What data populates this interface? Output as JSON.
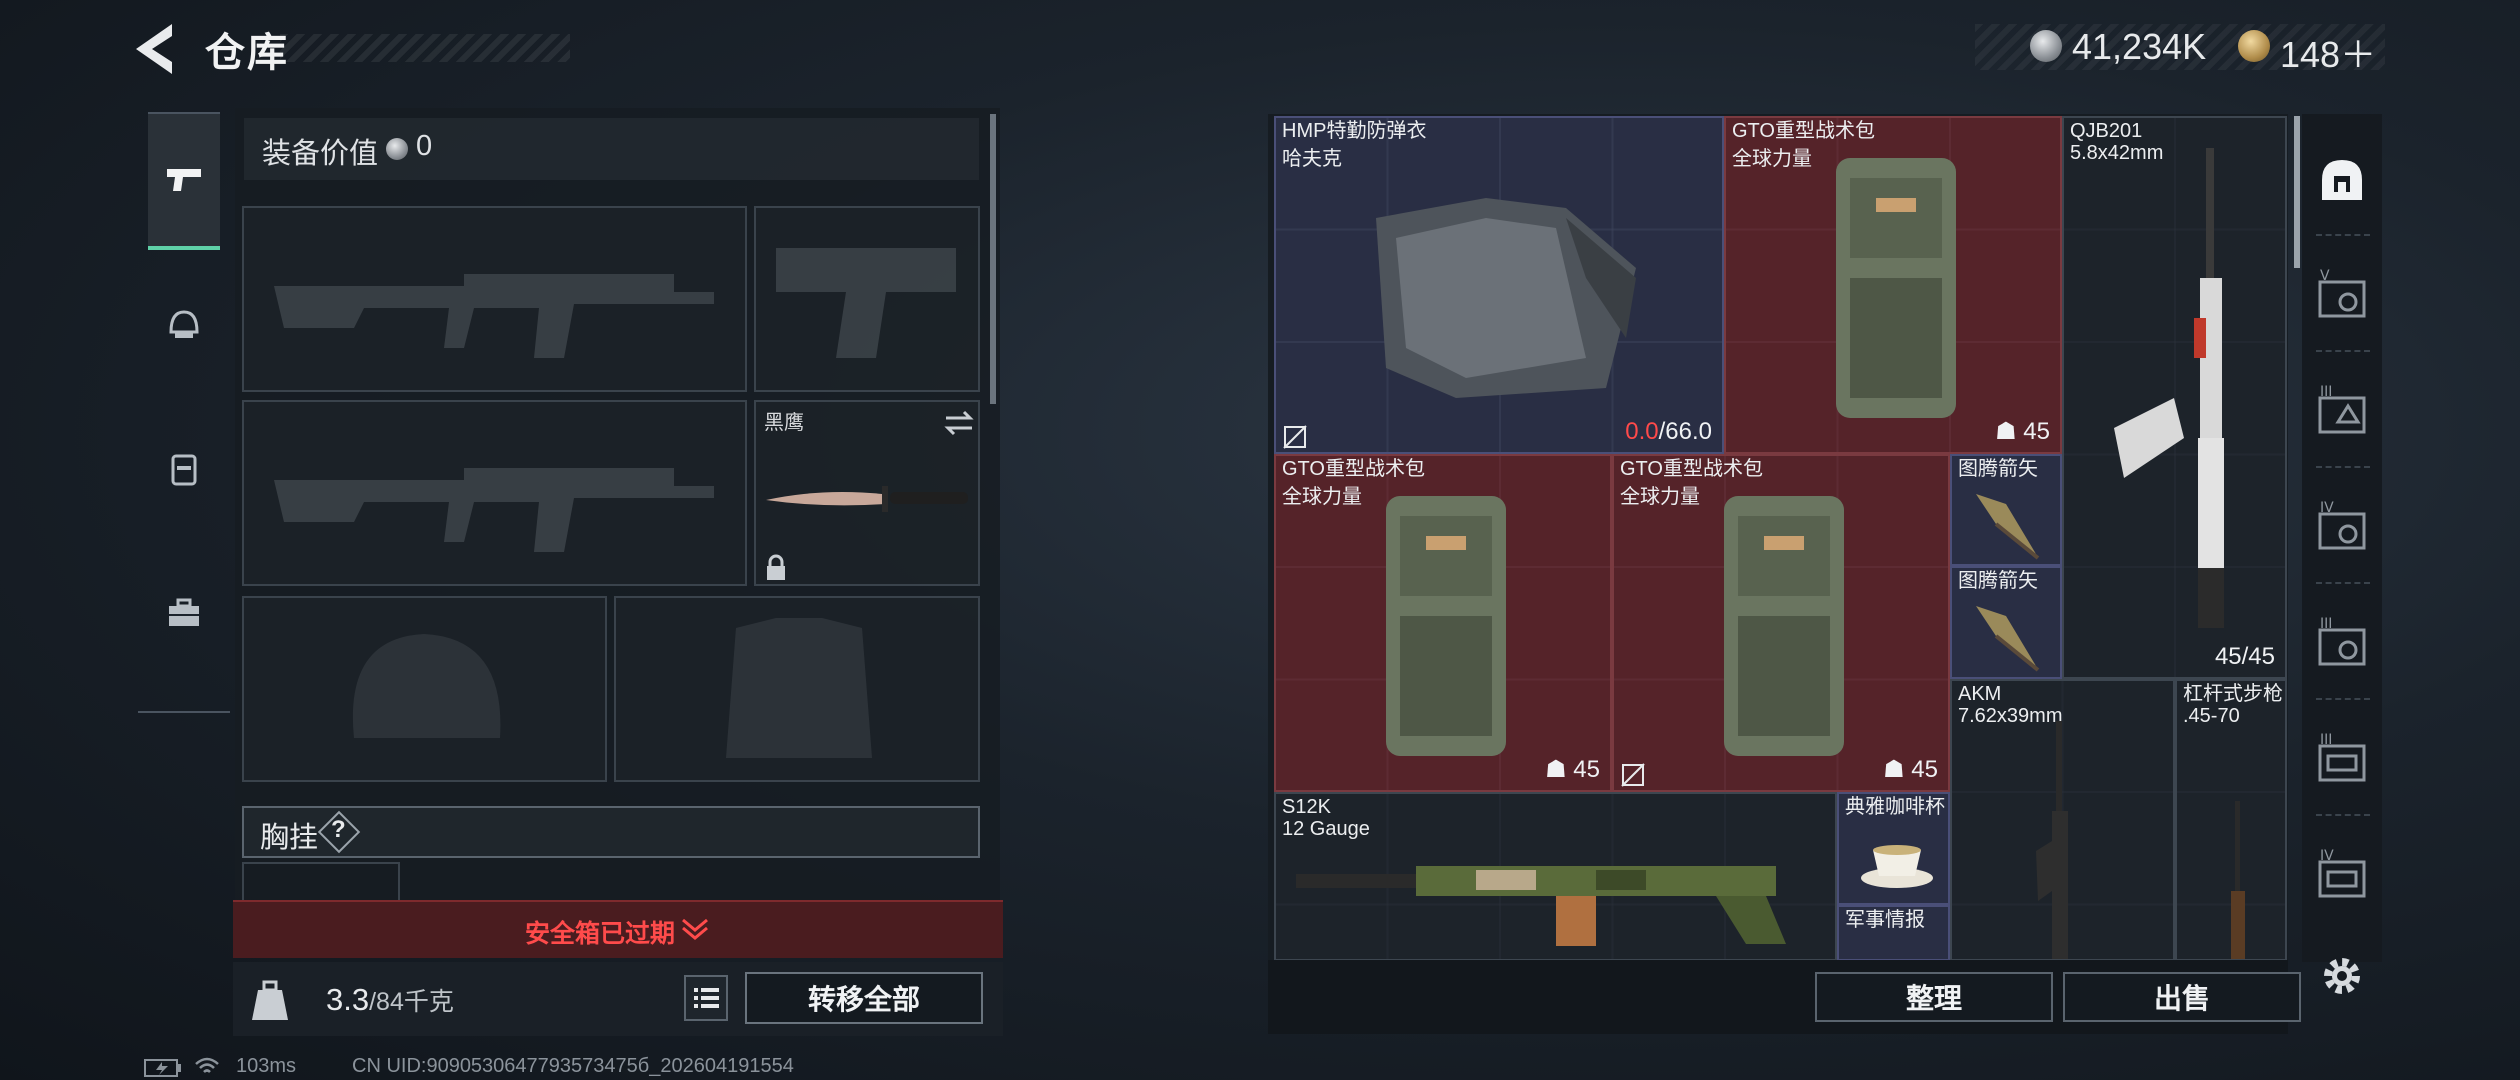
{
  "header": {
    "title": "仓库",
    "silver_amount": "41,234K",
    "gold_amount": "148＋"
  },
  "equipment": {
    "value_label": "装备价值",
    "value": "0",
    "melee_name": "黑鹰",
    "chest_label": "胸挂",
    "chest_help": "?"
  },
  "safe_box": {
    "status": "安全箱已过期"
  },
  "backpack": {
    "weight": "3.3",
    "capacity": "/84千克",
    "move_all": "转移全部"
  },
  "stash": {
    "items": [
      {
        "name": "HMP特勤防弹衣",
        "sub": "哈夫克",
        "durability": "0.0",
        "durability_max": "/66.0"
      },
      {
        "name": "GTO重型战术包",
        "sub": "全球力量",
        "count": "45"
      },
      {
        "name": "QJB201",
        "sub": "5.8x42mm",
        "ammo": "45/45"
      },
      {
        "name": "GTO重型战术包",
        "sub": "全球力量"
      },
      {
        "name": "GTO重型战术包",
        "sub": "全球力量",
        "count": "45"
      },
      {
        "name": "图腾箭矢"
      },
      {
        "name": "图腾箭矢"
      },
      {
        "name": "AKM",
        "sub": "7.62x39mm"
      },
      {
        "name": "杠杆式步枪",
        "sub": ".45-70"
      },
      {
        "name": "S12K",
        "sub": "12 Gauge"
      },
      {
        "name": "典雅咖啡杯"
      },
      {
        "name": "军事情报"
      }
    ],
    "left_count": "45",
    "sort_label": "整理",
    "sell_label": "出售"
  },
  "right_rail": {
    "tiers": [
      "V",
      "III",
      "IV",
      "III",
      "III",
      "IV"
    ]
  },
  "status_bar": {
    "ping": "103ms",
    "uid": "CN UID:9090530647793573475б_202604191554"
  }
}
